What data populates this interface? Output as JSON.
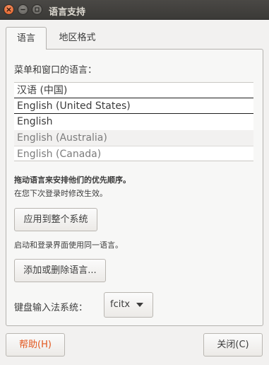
{
  "window": {
    "title": "语言支持"
  },
  "tabs": [
    {
      "label": "语言",
      "active": true
    },
    {
      "label": "地区格式",
      "active": false
    }
  ],
  "language_section": {
    "heading": "菜单和窗口的语言：",
    "items": [
      {
        "label": "汉语 (中国)",
        "active": true
      },
      {
        "label": "English (United States)",
        "active": true
      },
      {
        "label": "English",
        "active": true
      },
      {
        "label": "English (Australia)",
        "active": false
      },
      {
        "label": "English (Canada)",
        "active": false
      }
    ],
    "drag_hint": "拖动语言来安排他们的优先顺序。",
    "effect_hint": "在您下次登录时修改生效。",
    "apply_system_button": "应用到整个系统",
    "login_hint": "启动和登录界面使用同一语言。",
    "add_remove_button": "添加或删除语言...",
    "keyboard_label": "键盘输入法系统：",
    "keyboard_value": "fcitx"
  },
  "footer": {
    "help_button": "帮助(H)",
    "close_button": "关闭(C)"
  },
  "colors": {
    "accent": "#e2561d",
    "titlebar": "#3c3b37",
    "background": "#f2f1f0"
  },
  "icons": [
    "close-icon",
    "minimize-icon",
    "maximize-icon",
    "dropdown-arrow-icon"
  ]
}
